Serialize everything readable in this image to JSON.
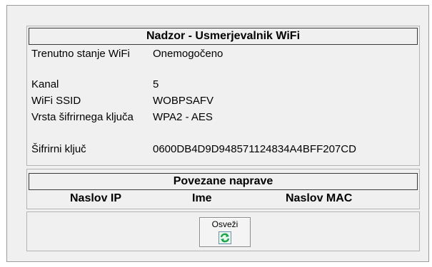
{
  "status": {
    "title": "Nadzor - Usmerjevalnik WiFi",
    "rows": [
      {
        "label": "Trenutno stanje WiFi",
        "value": "Onemogočeno"
      },
      {
        "label": "Kanal",
        "value": "5"
      },
      {
        "label": "WiFi SSID",
        "value": "WOBPSAFV"
      },
      {
        "label": "Vrsta šifrirnega ključa",
        "value": "WPA2 - AES"
      },
      {
        "label": "Šifrirni ključ",
        "value": "0600DB4D9D948571124834A4BFF207CD"
      }
    ]
  },
  "devices": {
    "title": "Povezane naprave",
    "columns": [
      "Naslov IP",
      "Ime",
      "Naslov MAC"
    ]
  },
  "refresh_button": {
    "label": "Osveži",
    "icon": "refresh-icon",
    "icon_color": "#1aa34a"
  }
}
